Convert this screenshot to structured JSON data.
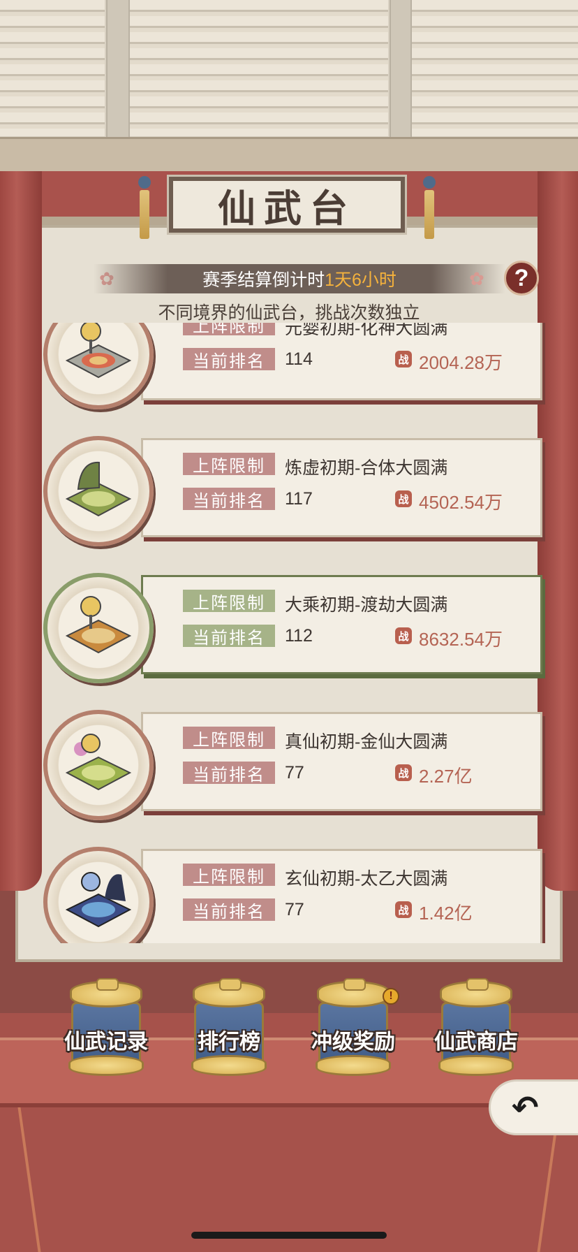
{
  "title": "仙武台",
  "countdown": {
    "label": "赛季结算倒计时",
    "time": "1天6小时"
  },
  "help_label": "?",
  "subtitle": "不同境界的仙武台，挑战次数独立",
  "arenas": [
    {
      "limit_tag": "上阵限制",
      "limit": "元婴初期-化神大圆满",
      "rank_tag": "当前排名",
      "rank": "114",
      "power": "2004.28万",
      "theme": "red"
    },
    {
      "limit_tag": "上阵限制",
      "limit": "炼虚初期-合体大圆满",
      "rank_tag": "当前排名",
      "rank": "117",
      "power": "4502.54万",
      "theme": "red"
    },
    {
      "limit_tag": "上阵限制",
      "limit": "大乘初期-渡劫大圆满",
      "rank_tag": "当前排名",
      "rank": "112",
      "power": "8632.54万",
      "theme": "green"
    },
    {
      "limit_tag": "上阵限制",
      "limit": "真仙初期-金仙大圆满",
      "rank_tag": "当前排名",
      "rank": "77",
      "power": "2.27亿",
      "theme": "red"
    },
    {
      "limit_tag": "上阵限制",
      "limit": "玄仙初期-太乙大圆满",
      "rank_tag": "当前排名",
      "rank": "77",
      "power": "1.42亿",
      "theme": "red"
    }
  ],
  "bottom_buttons": [
    {
      "label": "仙武记录",
      "alert": false
    },
    {
      "label": "排行榜",
      "alert": false
    },
    {
      "label": "冲级奖励",
      "alert": true
    },
    {
      "label": "仙武商店",
      "alert": false
    }
  ],
  "back_icon": "back-arrow-icon",
  "colors": {
    "countdown_time": "#f5b23c",
    "power_value": "#b46454",
    "tag_red": "#c08d8a",
    "tag_green": "#a6b388"
  }
}
